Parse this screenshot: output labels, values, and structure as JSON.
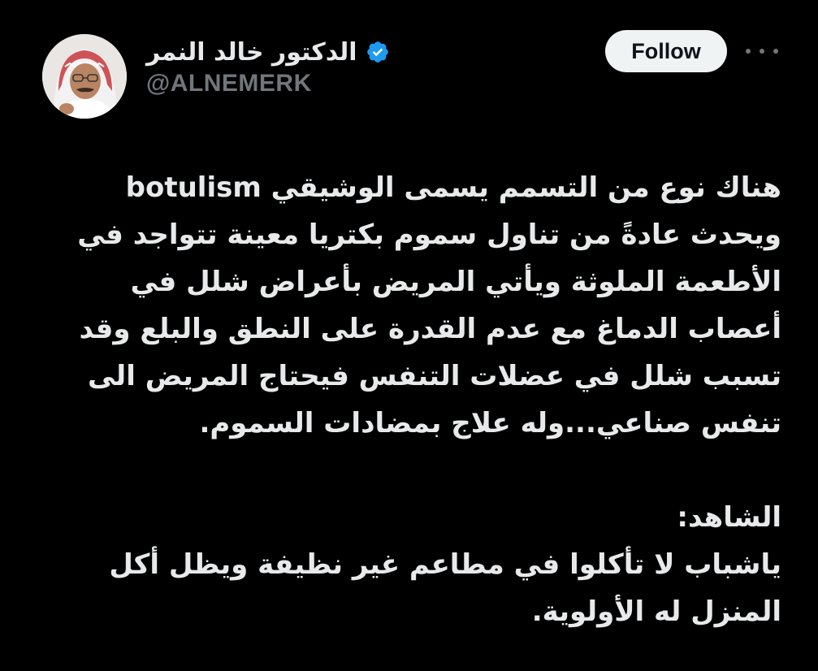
{
  "author": {
    "display_name": "الدكتور خالد النمر",
    "handle": "@ALNEMERK",
    "verified": true,
    "verified_color": "#1d9bf0",
    "avatar_icon": "profile-photo"
  },
  "actions": {
    "follow_label": "Follow",
    "more_icon": "ellipsis-icon"
  },
  "tweet": {
    "paragraph1": [
      "هناك نوع من التسمم يسمى  الوشيقي botulism",
      "ويحدث عادةً من تناول سموم بكتريا معينة تتواجد في",
      "الأطعمة الملوثة ويأتي المريض بأعراض شلل في",
      "أعصاب الدماغ مع عدم القدرة على النطق والبلع وقد",
      "تسبب شلل في  عضلات التنفس فيحتاج المريض الى",
      "تنفس صناعي...وله علاج بمضادات السموم."
    ],
    "paragraph2": [
      "الشاهد:",
      "ياشباب لا تأكلوا في مطاعم غير نظيفة ويظل أكل",
      "المنزل له الأولوية."
    ]
  },
  "colors": {
    "background": "#000000",
    "text_primary": "#e7e9ea",
    "text_secondary": "#71767b",
    "follow_bg": "#eff3f4",
    "follow_text": "#0f1419"
  }
}
